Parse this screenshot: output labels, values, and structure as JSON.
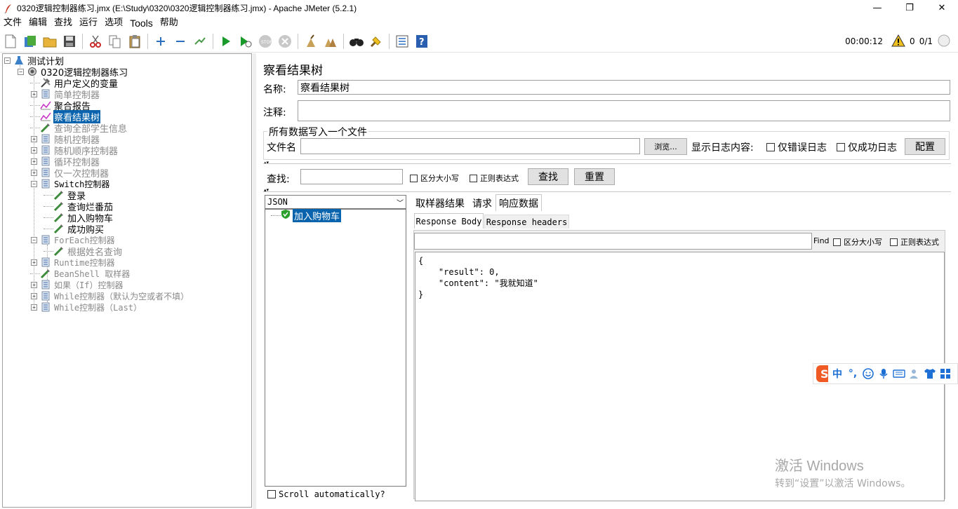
{
  "window": {
    "title": "0320逻辑控制器练习.jmx (E:\\Study\\0320\\0320逻辑控制器练习.jmx) - Apache JMeter (5.2.1)",
    "minimize": "—",
    "maximize": "❐",
    "close": "✕"
  },
  "menu": [
    "文件",
    "编辑",
    "查找",
    "运行",
    "选项",
    "Tools",
    "帮助"
  ],
  "toolbar": {
    "icons": [
      "new-icon",
      "templates-icon",
      "open-icon",
      "save-icon",
      "cut-icon",
      "copy-icon",
      "paste-icon",
      "expand-icon",
      "collapse-icon",
      "toggle-icon",
      "start-icon",
      "start-no-pause-icon",
      "stop-icon",
      "shutdown-icon",
      "clear-icon",
      "clear-all-icon",
      "search-icon",
      "reset-search-icon",
      "function-helper-icon",
      "help-icon"
    ],
    "timer": "00:00:12",
    "warnings": "0",
    "threads": "0/1"
  },
  "tree": {
    "items": [
      {
        "label": "测试计划",
        "icon": "test-plan-icon",
        "expander": "−",
        "style": "normal"
      },
      {
        "label": "0320逻辑控制器练习",
        "icon": "thread-group-icon",
        "expander": "−",
        "style": "normal"
      },
      {
        "label": "用户定义的变量",
        "icon": "config-icon",
        "expander": "",
        "style": "normal"
      },
      {
        "label": "简单控制器",
        "icon": "controller-icon",
        "expander": "+",
        "style": "disabled"
      },
      {
        "label": "聚合报告",
        "icon": "listener-icon",
        "expander": "",
        "style": "normal"
      },
      {
        "label": "察看结果树",
        "icon": "listener-icon",
        "expander": "",
        "style": "selected"
      },
      {
        "label": "查询全部学生信息",
        "icon": "sampler-icon",
        "expander": "",
        "style": "disabled"
      },
      {
        "label": "随机控制器",
        "icon": "controller-icon",
        "expander": "+",
        "style": "disabled"
      },
      {
        "label": "随机顺序控制器",
        "icon": "controller-icon",
        "expander": "+",
        "style": "disabled"
      },
      {
        "label": "循环控制器",
        "icon": "controller-icon",
        "expander": "+",
        "style": "disabled"
      },
      {
        "label": "仅一次控制器",
        "icon": "controller-icon",
        "expander": "+",
        "style": "disabled"
      },
      {
        "label": "Switch控制器",
        "icon": "controller-icon",
        "expander": "−",
        "style": "normal"
      },
      {
        "label": "登录",
        "icon": "sampler-icon",
        "expander": "",
        "style": "normal"
      },
      {
        "label": "查询烂番茄",
        "icon": "sampler-icon",
        "expander": "",
        "style": "normal"
      },
      {
        "label": "加入购物车",
        "icon": "sampler-icon",
        "expander": "",
        "style": "normal"
      },
      {
        "label": "成功购买",
        "icon": "sampler-icon",
        "expander": "",
        "style": "normal"
      },
      {
        "label": "ForEach控制器",
        "icon": "controller-icon",
        "expander": "−",
        "style": "disabled"
      },
      {
        "label": "根据姓名查询",
        "icon": "sampler-icon",
        "expander": "",
        "style": "disabled"
      },
      {
        "label": "Runtime控制器",
        "icon": "controller-icon",
        "expander": "+",
        "style": "disabled"
      },
      {
        "label": "BeanShell 取样器",
        "icon": "sampler-icon",
        "expander": "",
        "style": "disabled"
      },
      {
        "label": "如果（If）控制器",
        "icon": "controller-icon",
        "expander": "+",
        "style": "disabled"
      },
      {
        "label": "While控制器（默认为空或者不填）",
        "icon": "controller-icon",
        "expander": "+",
        "style": "disabled"
      },
      {
        "label": "While控制器（Last）",
        "icon": "controller-icon",
        "expander": "+",
        "style": "disabled"
      }
    ]
  },
  "panel": {
    "title": "察看结果树",
    "name_label": "名称:",
    "name_value": "察看结果树",
    "comment_label": "注释:",
    "comment_value": "",
    "file_group_title": "所有数据写入一个文件",
    "filename_label": "文件名",
    "filename_value": "",
    "browse_button": "浏览...",
    "log_content_label": "显示日志内容:",
    "errors_only": "仅错误日志",
    "success_only": "仅成功日志",
    "configure_button": "配置",
    "search_label": "查找:",
    "search_value": "",
    "case_sensitive": "区分大小写",
    "regex": "正则表达式",
    "find_button": "查找",
    "reset_button": "重置"
  },
  "results": {
    "renderer": "JSON",
    "items": [
      "加入购物车"
    ],
    "scroll_automatically": "Scroll automatically?"
  },
  "tabs": {
    "main": [
      "取样器结果",
      "请求",
      "响应数据"
    ],
    "active_main": "响应数据",
    "sub": [
      "Response Body",
      "Response headers"
    ],
    "find_label": "Find",
    "find_value": "",
    "case_sensitive": "区分大小写",
    "regex": "正则表达式"
  },
  "response_body": "{\n    \"result\": 0,\n    \"content\": \"我就知道\"\n}",
  "ime": {
    "lang": "中",
    "punct": "°,"
  },
  "watermark": {
    "line1": "激活 Windows",
    "line2": "转到“设置”以激活 Windows。"
  },
  "colors": {
    "selection": "#0a64ad",
    "disabled_text": "#8a8a8a",
    "run_green": "#1a9a2a",
    "ime_orange": "#f05a24"
  }
}
